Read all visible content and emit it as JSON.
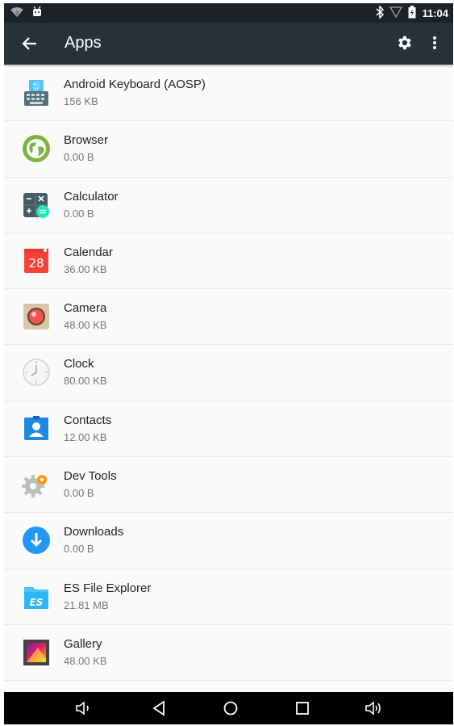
{
  "status_bar": {
    "time": "11:04",
    "icons": [
      "wifi-unknown-icon",
      "android-debug-icon",
      "bluetooth-icon",
      "signal-icon",
      "battery-icon"
    ]
  },
  "app_bar": {
    "title": "Apps",
    "icons": [
      "back-arrow-icon",
      "gear-icon",
      "more-vert-icon"
    ]
  },
  "apps": [
    {
      "name": "Android Keyboard (AOSP)",
      "size": "156 KB",
      "icon": "keyboard-icon"
    },
    {
      "name": "Browser",
      "size": "0.00 B",
      "icon": "globe-icon"
    },
    {
      "name": "Calculator",
      "size": "0.00 B",
      "icon": "calculator-icon"
    },
    {
      "name": "Calendar",
      "size": "36.00 KB",
      "icon": "calendar-icon",
      "icon_text": "28"
    },
    {
      "name": "Camera",
      "size": "48.00 KB",
      "icon": "camera-icon"
    },
    {
      "name": "Clock",
      "size": "80.00 KB",
      "icon": "clock-icon"
    },
    {
      "name": "Contacts",
      "size": "12.00 KB",
      "icon": "contacts-icon"
    },
    {
      "name": "Dev Tools",
      "size": "0.00 B",
      "icon": "dev-tools-icon"
    },
    {
      "name": "Downloads",
      "size": "0.00 B",
      "icon": "download-icon"
    },
    {
      "name": "ES File Explorer",
      "size": "21.81 MB",
      "icon": "es-file-explorer-icon",
      "icon_text": "ES"
    },
    {
      "name": "Gallery",
      "size": "48.00 KB",
      "icon": "gallery-icon"
    }
  ],
  "nav_bar": {
    "icons": [
      "volume-down-icon",
      "back-icon",
      "home-icon",
      "recents-icon",
      "volume-up-icon"
    ]
  },
  "colors": {
    "status_bar": "#1c2226",
    "app_bar": "#263238",
    "background": "#fafafa",
    "nav_bar": "#000000"
  }
}
